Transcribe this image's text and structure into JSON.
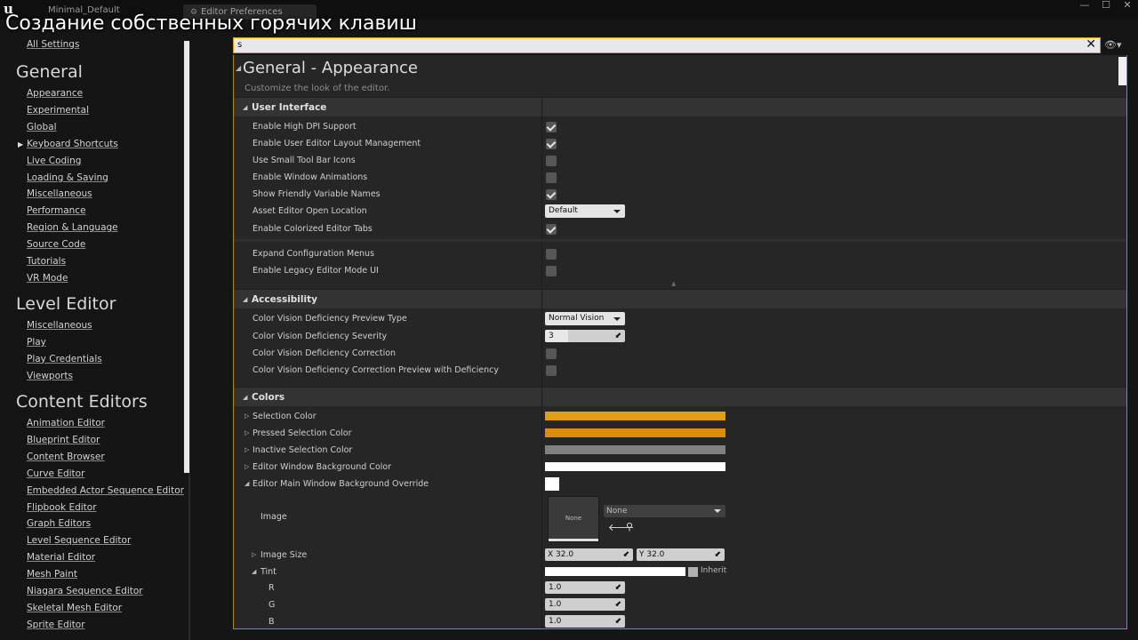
{
  "caption": "Создание собственных горячих клавиш",
  "titlebar": {
    "project_tab": "Minimal_Default",
    "prefs_tab": "Editor Preferences",
    "minimize": "—",
    "maximize": "☐",
    "close": "✕"
  },
  "sidebar": {
    "all_settings": "All Settings",
    "general": {
      "heading": "General",
      "items": [
        "Appearance",
        "Experimental",
        "Global",
        "Keyboard Shortcuts",
        "Live Coding",
        "Loading & Saving",
        "Miscellaneous",
        "Performance",
        "Region & Language",
        "Source Code",
        "Tutorials",
        "VR Mode"
      ]
    },
    "level_editor": {
      "heading": "Level Editor",
      "items": [
        "Miscellaneous",
        "Play",
        "Play Credentials",
        "Viewports"
      ]
    },
    "content_editors": {
      "heading": "Content Editors",
      "items": [
        "Animation Editor",
        "Blueprint Editor",
        "Content Browser",
        "Curve Editor",
        "Embedded Actor Sequence Editor",
        "Flipbook Editor",
        "Graph Editors",
        "Level Sequence Editor",
        "Material Editor",
        "Mesh Paint",
        "Niagara Sequence Editor",
        "Skeletal Mesh Editor",
        "Sprite Editor"
      ]
    }
  },
  "search": {
    "value": "s",
    "clear": "✕"
  },
  "eye_icon": "👁▾",
  "main": {
    "title": "General - Appearance",
    "description": "Customize the look of the editor.",
    "user_interface": {
      "label": "User Interface",
      "rows": [
        {
          "label": "Enable High DPI Support",
          "checked": true
        },
        {
          "label": "Enable User Editor Layout Management",
          "checked": true
        },
        {
          "label": "Use Small Tool Bar Icons",
          "checked": false
        },
        {
          "label": "Enable Window Animations",
          "checked": false
        },
        {
          "label": "Show Friendly Variable Names",
          "checked": true
        },
        {
          "label": "Asset Editor Open Location",
          "value": "Default"
        },
        {
          "label": "Enable Colorized Editor Tabs",
          "checked": true
        },
        {
          "label": "Expand Configuration Menus",
          "checked": false
        },
        {
          "label": "Enable Legacy Editor Mode UI",
          "checked": false
        }
      ]
    },
    "accessibility": {
      "label": "Accessibility",
      "rows": [
        {
          "label": "Color Vision Deficiency Preview Type",
          "value": "Normal Vision"
        },
        {
          "label": "Color Vision Deficiency Severity",
          "value": "3"
        },
        {
          "label": "Color Vision Deficiency Correction",
          "checked": false
        },
        {
          "label": "Color Vision Deficiency Correction Preview with Deficiency",
          "checked": false
        }
      ]
    },
    "colors": {
      "label": "Colors",
      "rows": [
        {
          "label": "Selection Color",
          "color": "#e0a010"
        },
        {
          "label": "Pressed Selection Color",
          "color": "#e08a10"
        },
        {
          "label": "Inactive Selection Color",
          "color": "#808080"
        },
        {
          "label": "Editor Window Background Color",
          "color": "#ffffff"
        },
        {
          "label": "Editor Main Window Background Override",
          "color": "#ffffff"
        }
      ],
      "image": {
        "label": "Image",
        "thumb": "None",
        "asset": "None"
      },
      "image_size": {
        "label": "Image Size",
        "x": "X  32.0",
        "y": "Y  32.0"
      },
      "tint": {
        "label": "Tint",
        "inherit": "Inherit"
      },
      "channels": [
        {
          "label": "R",
          "value": "1.0"
        },
        {
          "label": "G",
          "value": "1.0"
        },
        {
          "label": "B",
          "value": "1.0"
        }
      ]
    }
  }
}
